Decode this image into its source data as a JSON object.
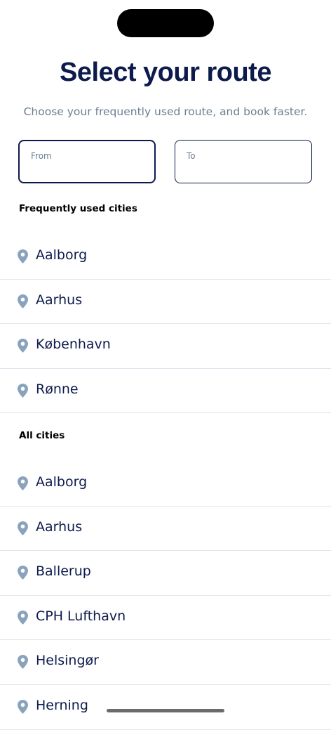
{
  "header": {
    "title": "Select your route",
    "subtitle": "Choose your frequently used route, and book faster."
  },
  "fields": {
    "from_label": "From",
    "from_value": "",
    "to_label": "To",
    "to_value": ""
  },
  "frequent": {
    "title": "Frequently used cities",
    "items": [
      "Aalborg",
      "Aarhus",
      "København",
      "Rønne"
    ]
  },
  "all": {
    "title": "All cities",
    "items": [
      "Aalborg",
      "Aarhus",
      "Ballerup",
      "CPH Lufthavn",
      "Helsingør",
      "Herning"
    ]
  },
  "icons": {
    "list_item": "location-pin-icon"
  },
  "colors": {
    "primary": "#0d1b4c",
    "muted": "#6a7f93",
    "pin": "#8aa3bd",
    "divider": "#dfe6ed"
  }
}
